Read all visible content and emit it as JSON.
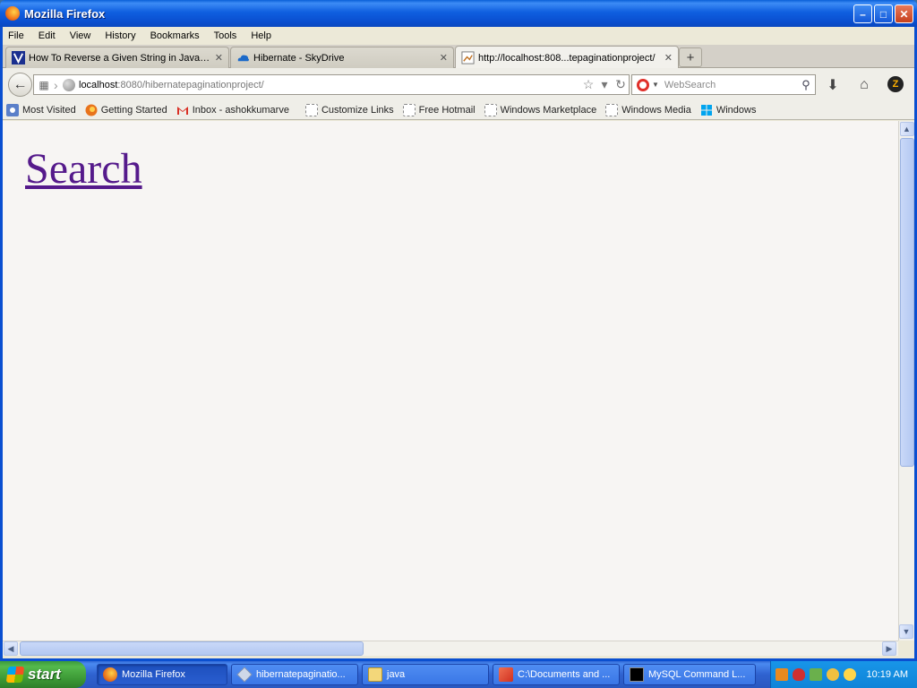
{
  "window": {
    "title": "Mozilla Firefox"
  },
  "menu": [
    "File",
    "Edit",
    "View",
    "History",
    "Bookmarks",
    "Tools",
    "Help"
  ],
  "tabs": [
    {
      "label": "How To Reverse a Given String in Java - ...",
      "icon": "v-logo-icon"
    },
    {
      "label": "Hibernate - SkyDrive",
      "icon": "skydrive-cloud-icon"
    },
    {
      "label": "http://localhost:808...tepaginationproject/",
      "icon": "page-icon"
    }
  ],
  "navbar": {
    "url_host": "localhost",
    "url_rest": ":8080/hibernatepaginationproject/",
    "search_placeholder": "WebSearch"
  },
  "bookmarks": [
    "Most Visited",
    "Getting Started",
    "Inbox - ashokkumarve",
    "Customize Links",
    "Free Hotmail",
    "Windows Marketplace",
    "Windows Media",
    "Windows"
  ],
  "content": {
    "link_text": "Search"
  },
  "taskbar": {
    "start_label": "start",
    "tasks": [
      "Mozilla Firefox",
      "hibernatepaginatio...",
      "java",
      "C:\\Documents and ...",
      "MySQL Command L..."
    ],
    "clock": "10:19 AM"
  },
  "colors": {
    "visited_link": "#551a8b",
    "titlebar_blue": "#0a4fd0",
    "start_green": "#3a9634"
  }
}
